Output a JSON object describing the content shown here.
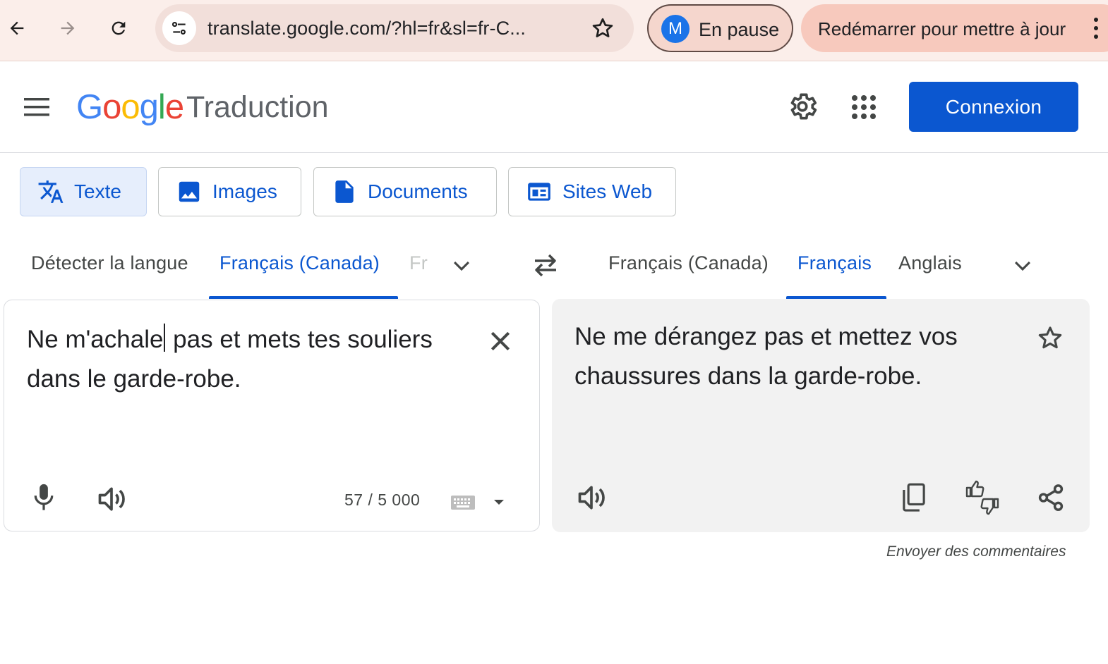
{
  "browser": {
    "url": "translate.google.com/?hl=fr&sl=fr-C...",
    "profile_initial": "M",
    "profile_status": "En pause",
    "update_label": "Redémarrer pour mettre à jour"
  },
  "header": {
    "logo": {
      "g1": "G",
      "o1": "o",
      "o2": "o",
      "g2": "g",
      "l": "l",
      "e": "e"
    },
    "product_name": "Traduction",
    "signin_label": "Connexion"
  },
  "modes": [
    {
      "label": "Texte",
      "icon": "translate-icon",
      "active": true
    },
    {
      "label": "Images",
      "icon": "image-icon",
      "active": false
    },
    {
      "label": "Documents",
      "icon": "document-icon",
      "active": false
    },
    {
      "label": "Sites Web",
      "icon": "website-icon",
      "active": false
    }
  ],
  "source_languages": {
    "detect": "Détecter la langue",
    "selected": "Français (Canada)",
    "truncated": "Fr"
  },
  "target_languages": {
    "option1": "Français (Canada)",
    "selected": "Français",
    "option3": "Anglais"
  },
  "source": {
    "text_before_caret": "Ne m'achale",
    "text_after_caret": " pas et mets tes souliers dans le garde-robe.",
    "char_count": "57 / 5 000"
  },
  "target": {
    "text": "Ne me dérangez pas et mettez vos chaussures dans la garde-robe."
  },
  "feedback_link": "Envoyer des commentaires",
  "colors": {
    "accent": "#0b57d0",
    "chrome_bg": "#fbeeea",
    "update_chip": "#f7c9bd",
    "target_panel_bg": "#f2f2f2"
  }
}
